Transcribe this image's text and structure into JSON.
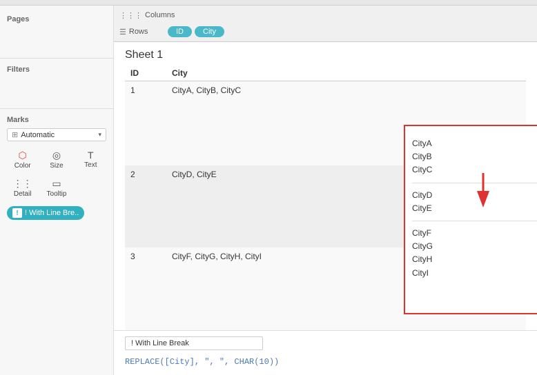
{
  "sidebar": {
    "pages_title": "Pages",
    "filters_title": "Filters",
    "marks_title": "Marks",
    "marks_dropdown": "Automatic",
    "marks_buttons": [
      {
        "label": "Color",
        "icon": "⬡"
      },
      {
        "label": "Size",
        "icon": "◎"
      },
      {
        "label": "Text",
        "icon": "T"
      },
      {
        "label": "Detail",
        "icon": "⋮⋮"
      },
      {
        "label": "Tooltip",
        "icon": "▭"
      }
    ],
    "with_line_break_label": "! With Line Bre.."
  },
  "shelf": {
    "columns_label": "Columns",
    "rows_label": "Rows",
    "rows_pills": [
      "ID",
      "City"
    ]
  },
  "sheet": {
    "title": "Sheet 1",
    "table_headers": [
      "ID",
      "City"
    ],
    "rows": [
      {
        "id": "1",
        "city": "CityA, CityB, CityC"
      },
      {
        "id": "2",
        "city": "CityD, CityE"
      },
      {
        "id": "3",
        "city": "CityF, CityG, CityH, CityI"
      }
    ]
  },
  "highlight_box": {
    "groups": [
      {
        "cities": [
          "CityA",
          "CityB",
          "CityC"
        ]
      },
      {
        "cities": [
          "CityD",
          "CityE"
        ]
      },
      {
        "cities": [
          "CityF",
          "CityG",
          "CityH",
          "CityI"
        ]
      }
    ]
  },
  "bottom": {
    "formula_label": "! With Line Break",
    "formula_code": "REPLACE([City], \", \", CHAR(10))"
  }
}
